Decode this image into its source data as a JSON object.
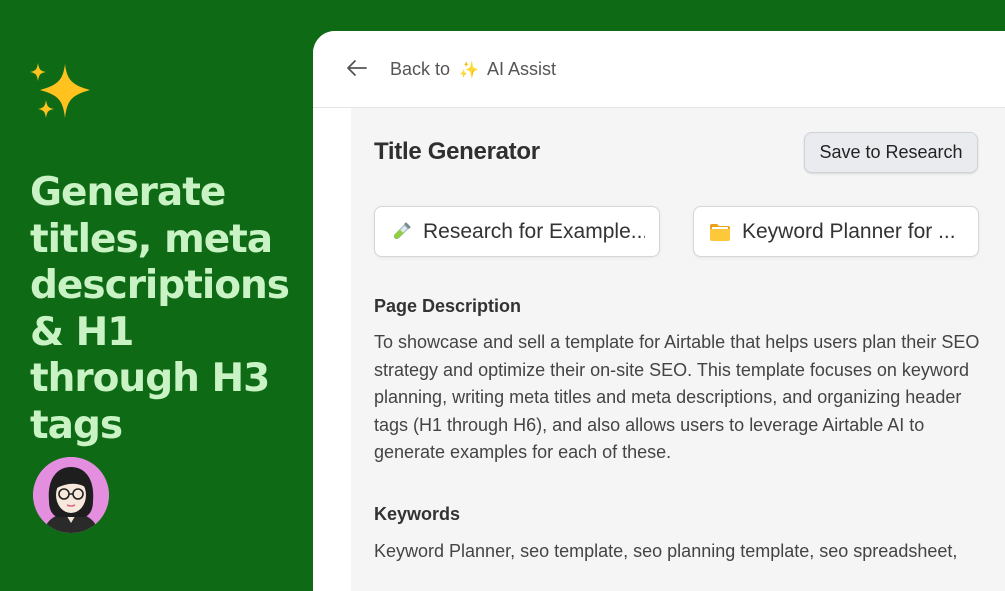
{
  "promo": {
    "headline": "Generate titles, meta descriptions & H1 through H3 tags",
    "sparkle_icon": "sparkles-icon",
    "avatar_icon": "avatar",
    "colors": {
      "background": "#0f6a15",
      "headline": "#c9f3c5",
      "sparkle": "#ffc21f",
      "avatar_ring": "#e48ee0"
    }
  },
  "topbar": {
    "back_icon": "arrow-left-icon",
    "back_prefix": "Back to",
    "back_emoji": "✨",
    "back_target": "AI Assist"
  },
  "panel": {
    "title": "Title Generator",
    "save_label": "Save to Research",
    "chips": [
      {
        "icon": "test-tube-icon",
        "label": "Research for Example..."
      },
      {
        "icon": "folder-icon",
        "label": "Keyword Planner for ..."
      }
    ],
    "page_description": {
      "label": "Page Description",
      "text": "To showcase and sell a template for Airtable that helps users plan their SEO strategy and optimize their on-site SEO. This template focuses on keyword planning, writing meta titles and meta descriptions, and organizing header tags (H1 through H6), and also allows users to leverage Airtable AI to generate examples for each of these."
    },
    "keywords": {
      "label": "Keywords",
      "text": "Keyword Planner, seo template, seo planning template, seo spreadsheet,"
    }
  }
}
